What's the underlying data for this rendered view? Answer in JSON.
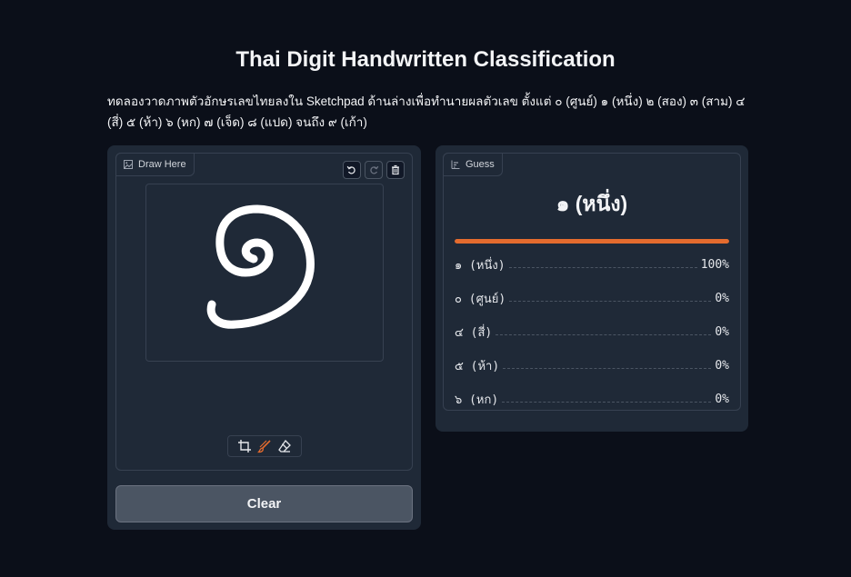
{
  "page": {
    "title": "Thai Digit Handwritten Classification",
    "description": "ทดลองวาดภาพตัวอักษรเลขไทยลงใน Sketchpad ด้านล่างเพื่อทำนายผลตัวเลข ตั้งแต่ ๐ (ศูนย์) ๑ (หนึ่ง) ๒ (สอง) ๓ (สาม) ๔ (สี่) ๕ (ห้า) ๖ (หก) ๗ (เจ็ด) ๘ (แปด) จนถึง ๙ (เก้า)"
  },
  "sketchpad": {
    "label": "Draw Here",
    "label_icon": "image-icon",
    "top_tools": [
      "undo-icon",
      "redo-icon",
      "trash-icon"
    ],
    "bottom_tools": [
      "crop-icon",
      "brush-icon",
      "eraser-icon"
    ],
    "active_tool": "brush-icon",
    "clear_label": "Clear"
  },
  "result": {
    "label": "Guess",
    "label_icon": "bar-chart-icon",
    "prediction": "๑ (หนึ่ง)",
    "top_confidence": 1.0,
    "accent_color": "#e46b2e",
    "confidences": [
      {
        "label": "๑ (หนึ่ง)",
        "value": "100%"
      },
      {
        "label": "๐ (ศูนย์)",
        "value": "0%"
      },
      {
        "label": "๔ (สี่)",
        "value": "0%"
      },
      {
        "label": "๕ (ห้า)",
        "value": "0%"
      },
      {
        "label": "๖ (หก)",
        "value": "0%"
      }
    ]
  }
}
